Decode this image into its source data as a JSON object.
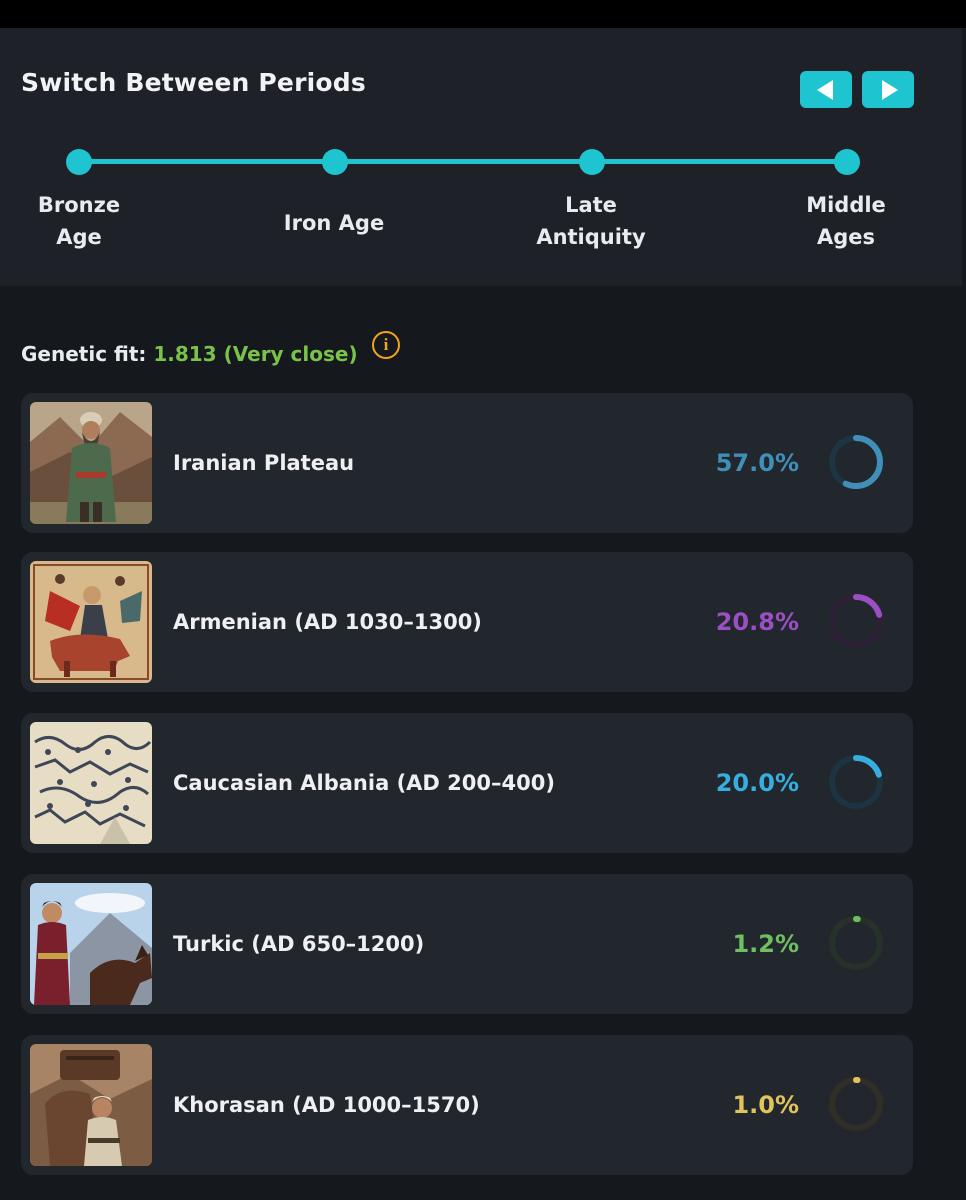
{
  "header": {
    "title": "Switch Between Periods",
    "prev_icon": "triangle-left-icon",
    "next_icon": "triangle-right-icon",
    "accent": "#1ec4cf"
  },
  "timeline": {
    "periods": [
      {
        "label_line1": "Bronze",
        "label_line2": "Age"
      },
      {
        "label_line1": "Iron Age",
        "label_line2": ""
      },
      {
        "label_line1": "Late",
        "label_line2": "Antiquity"
      },
      {
        "label_line1": "Middle",
        "label_line2": "Ages"
      }
    ]
  },
  "fit": {
    "label": "Genetic fit:",
    "value": "1.813 (Very close)",
    "value_color": "#7bc24a",
    "info_icon": "info-icon"
  },
  "populations": [
    {
      "name": "Iranian Plateau",
      "percent": "57.0%",
      "fraction": 0.57,
      "color": "#3f8fb8",
      "track": "#1d3442"
    },
    {
      "name": "Armenian (AD 1030–1300)",
      "percent": "20.8%",
      "fraction": 0.208,
      "color": "#9b4fc4",
      "track": "#2c2037"
    },
    {
      "name": "Caucasian Albania (AD 200–400)",
      "percent": "20.0%",
      "fraction": 0.2,
      "color": "#36aee0",
      "track": "#1c3341"
    },
    {
      "name": "Turkic (AD 650–1200)",
      "percent": "1.2%",
      "fraction": 0.012,
      "color": "#6fbf62",
      "track": "#263229"
    },
    {
      "name": "Khorasan (AD 1000–1570)",
      "percent": "1.0%",
      "fraction": 0.01,
      "color": "#e0c35a",
      "track": "#302e26"
    }
  ]
}
